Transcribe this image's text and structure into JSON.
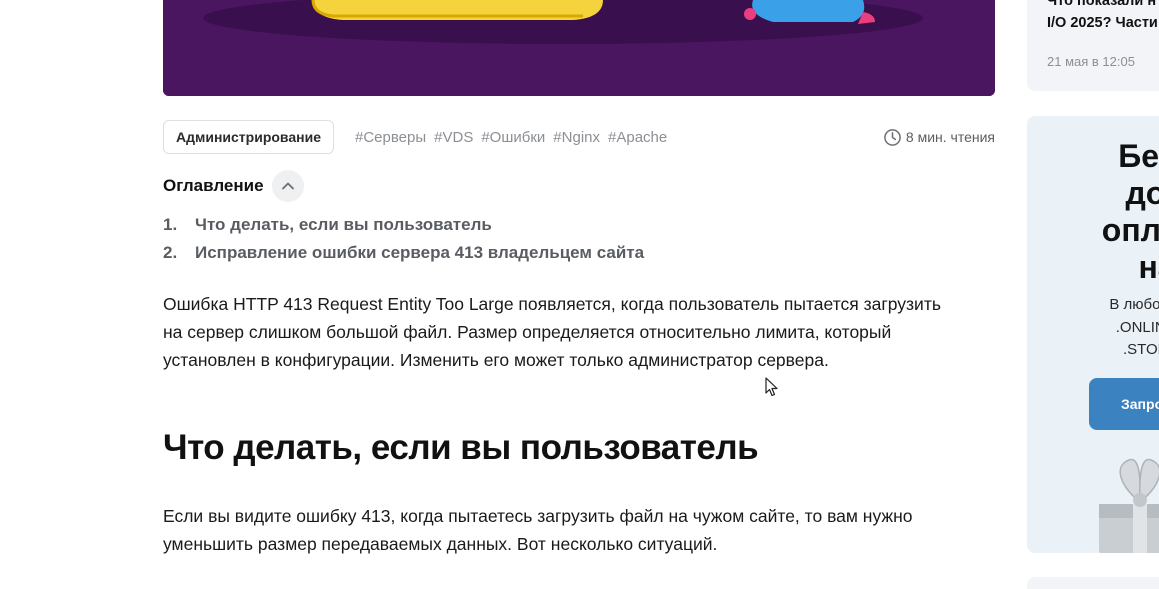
{
  "article": {
    "category": "Администрирование",
    "tags": [
      "#Серверы",
      "#VDS",
      "#Ошибки",
      "#Nginx",
      "#Apache"
    ],
    "read_time": "8 мин. чтения",
    "toc": {
      "title": "Оглавление",
      "items": [
        {
          "num": "1.",
          "label": "Что делать, если вы пользователь"
        },
        {
          "num": "2.",
          "label": "Исправление ошибки сервера 413 владельцем сайта"
        }
      ]
    },
    "intro_lines": [
      "Ошибка HTTP 413 Request Entity Too Large появляется, когда пользователь пытается загрузить",
      "на сервер слишком большой файл. Размер определяется относительно лимита, который",
      "установлен в конфигурации. Изменить его может только администратор сервера."
    ],
    "section_heading": "Что делать, если вы пользователь",
    "section_lines": [
      "Если вы видите ошибку 413, когда пытаетесь загрузить файл на чужом сайте, то вам нужно",
      "уменьшить размер передаваемых данных. Вот несколько ситуаций."
    ]
  },
  "sidebar": {
    "news": {
      "title_lines": [
        "Что показали н",
        "I/O 2025? Части"
      ],
      "date": "21 мая в 12:05"
    },
    "promo": {
      "title_lines": [
        "Бесп",
        "дом",
        "оплате",
        "на"
      ],
      "text_lines": [
        "В любой зоне",
        ".ONLINE, .S",
        ".STORE, ."
      ],
      "button": "Запро"
    }
  },
  "colors": {
    "hero_bg": "#4a1660",
    "accent_button": "#3b82c0",
    "card_bg": "#eaf1f7"
  },
  "icons": [
    "clock-icon",
    "chevron-up-icon",
    "mouse-cursor-icon",
    "gift-icon"
  ]
}
